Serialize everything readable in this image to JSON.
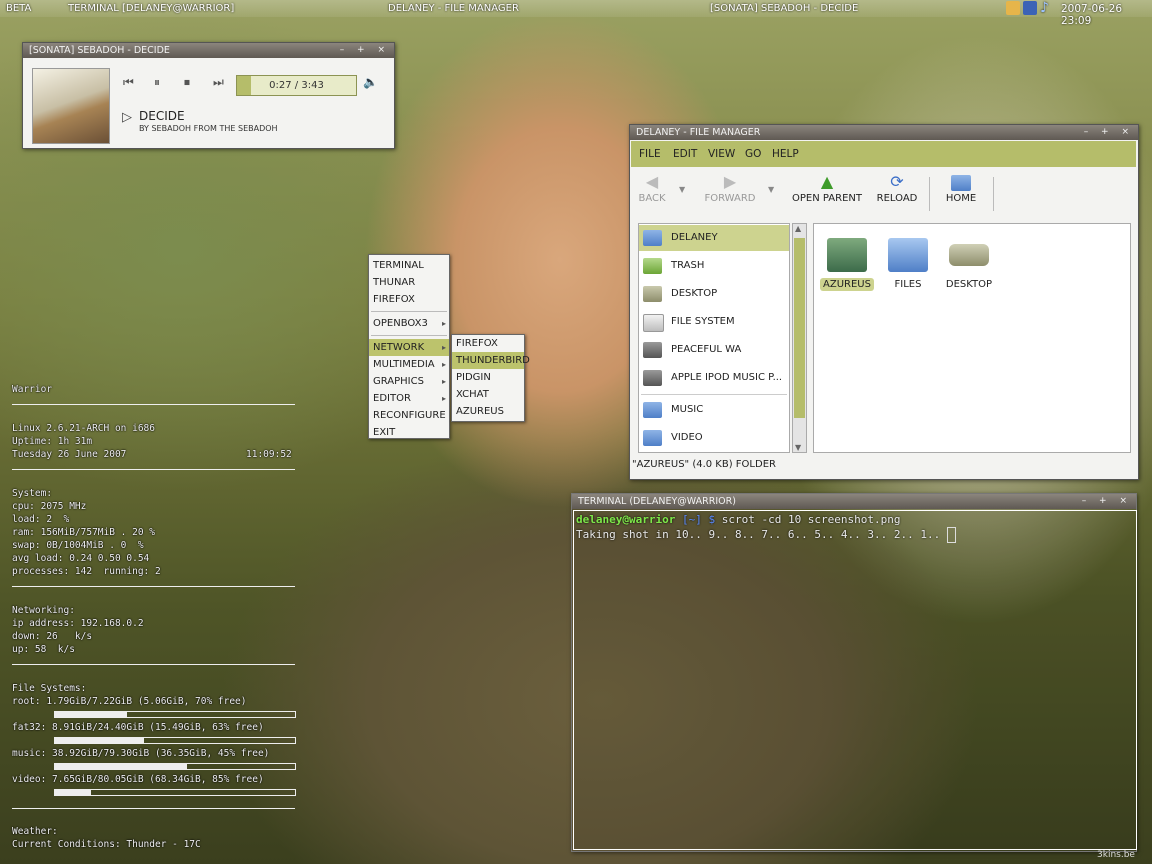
{
  "topbar": {
    "left_label": "BETA",
    "tasks": [
      "TERMINAL [DELANEY@WARRIOR]",
      "DELANEY - FILE MANAGER",
      "[SONATA] SEBADOH - DECIDE"
    ],
    "clock": "2007-06-26 23:09",
    "tray_icons": [
      "chat-icon",
      "thunderbird-icon",
      "music-note-icon"
    ]
  },
  "player": {
    "title": "[SONATA] SEBADOH - DECIDE",
    "time": "0:27 / 3:43",
    "progress_fraction": 0.12,
    "track": "DECIDE",
    "byline": "BY SEBADOH FROM THE SEBADOH",
    "controls": [
      "previous-icon",
      "pause-icon",
      "stop-icon",
      "next-icon",
      "volume-icon"
    ]
  },
  "menu": {
    "items": [
      "TERMINAL",
      "THUNAR",
      "FIREFOX",
      "OPENBOX3",
      "NETWORK",
      "MULTIMEDIA",
      "GRAPHICS",
      "EDITOR",
      "RECONFIGURE",
      "EXIT"
    ],
    "submenu": [
      "FIREFOX",
      "THUNDERBIRD",
      "PIDGIN",
      "XCHAT",
      "AZUREUS"
    ]
  },
  "file_manager": {
    "title": "DELANEY - FILE MANAGER",
    "menubar": [
      "FILE",
      "EDIT",
      "VIEW",
      "GO",
      "HELP"
    ],
    "toolbar": [
      "BACK",
      "FORWARD",
      "OPEN PARENT",
      "RELOAD",
      "HOME"
    ],
    "sidebar": [
      "DELANEY",
      "TRASH",
      "DESKTOP",
      "FILE SYSTEM",
      "PEACEFUL WA",
      "APPLE IPOD MUSIC P...",
      "MUSIC",
      "VIDEO"
    ],
    "files": [
      "AZUREUS",
      "FILES",
      "DESKTOP"
    ],
    "status": "\"AZUREUS\" (4.0 KB) FOLDER"
  },
  "terminal": {
    "title": "TERMINAL (DELANEY@WARRIOR)",
    "prompt_user": "delaney@warrior",
    "prompt_dir": "[~]",
    "prompt_symbol": "$",
    "command": "scrot -cd 10 screenshot.png",
    "output": "Taking shot in 10.. 9.. 8.. 7.. 6.. 5.. 4.. 3.. 2.. 1.."
  },
  "conky": {
    "host": "Warrior",
    "kernel": "Linux 2.6.21-ARCH on i686",
    "uptime": "Uptime: 1h 31m",
    "date": "Tuesday 26 June 2007",
    "time": "11:09:52",
    "system_header": "System:",
    "cpu": "cpu: 2075 MHz",
    "load": "load: 2  %",
    "ram": "ram: 156MiB/757MiB . 20 %",
    "swap": "swap: 0B/1004MiB . 0  %",
    "avg_load": "avg load: 0.24 0.50 0.54",
    "processes": "processes: 142  running: 2",
    "net_header": "Networking:",
    "ip": "ip address: 192.168.0.2",
    "down": "down: 26   k/s",
    "up": "up: 58  k/s",
    "fs_header": "File Systems:",
    "fs": [
      {
        "label": "root: 1.79GiB/7.22GiB (5.06GiB, 70% free)",
        "used": 0.3
      },
      {
        "label": "fat32: 8.91GiB/24.40GiB (15.49GiB, 63% free)",
        "used": 0.37
      },
      {
        "label": "music: 38.92GiB/79.30GiB (36.35GiB, 45% free)",
        "used": 0.55
      },
      {
        "label": "video: 7.65GiB/80.05GiB (68.34GiB, 85% free)",
        "used": 0.15
      }
    ],
    "weather_header": "Weather:",
    "weather": "Current Conditions: Thunder - 17C"
  },
  "watermark": "3kins.be"
}
